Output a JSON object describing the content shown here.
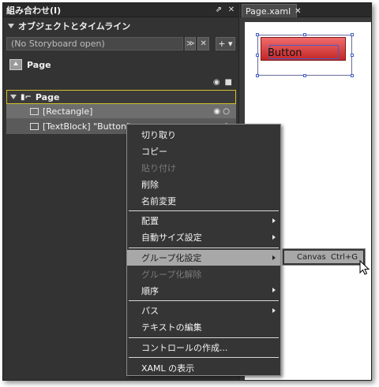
{
  "panel": {
    "title": "組み合わせ(I)",
    "pin_icon": "pin-icon",
    "close_icon": "close-icon",
    "section_title": "オブジェクトとタイムライン",
    "storyboard": {
      "value": "(No Storyboard open)"
    },
    "page_label": "Page",
    "tree": {
      "root_label": "Page",
      "items": [
        {
          "label": "[Rectangle]"
        },
        {
          "label": "[TextBlock] \"Button\""
        }
      ]
    }
  },
  "document": {
    "tab_label": "Page.xaml",
    "tab_close": "✕",
    "artboard_text": "Button"
  },
  "context_menu": {
    "groups": [
      [
        {
          "label": "切り取り",
          "disabled": false
        },
        {
          "label": "コピー",
          "disabled": false
        },
        {
          "label": "貼り付け",
          "disabled": true
        },
        {
          "label": "削除",
          "disabled": false
        },
        {
          "label": "名前変更",
          "disabled": false
        }
      ],
      [
        {
          "label": "配置",
          "submenu": true
        },
        {
          "label": "自動サイズ設定",
          "submenu": true
        }
      ],
      [
        {
          "label": "グループ化設定",
          "submenu": true,
          "highlighted": true
        },
        {
          "label": "グループ化解除",
          "disabled": true
        },
        {
          "label": "順序",
          "submenu": true
        }
      ],
      [
        {
          "label": "パス",
          "submenu": true
        },
        {
          "label": "テキストの編集"
        }
      ],
      [
        {
          "label": "コントロールの作成..."
        }
      ],
      [
        {
          "label": "XAML の表示"
        }
      ]
    ]
  },
  "submenu": {
    "item": "Canvas  Ctrl+G"
  },
  "colors": {
    "panel_bg": "#333333",
    "menu_bg": "#353535",
    "highlight": "#a8a8a8",
    "selection_border": "#d4c02a",
    "artboard_fill": "#d83a3a"
  }
}
